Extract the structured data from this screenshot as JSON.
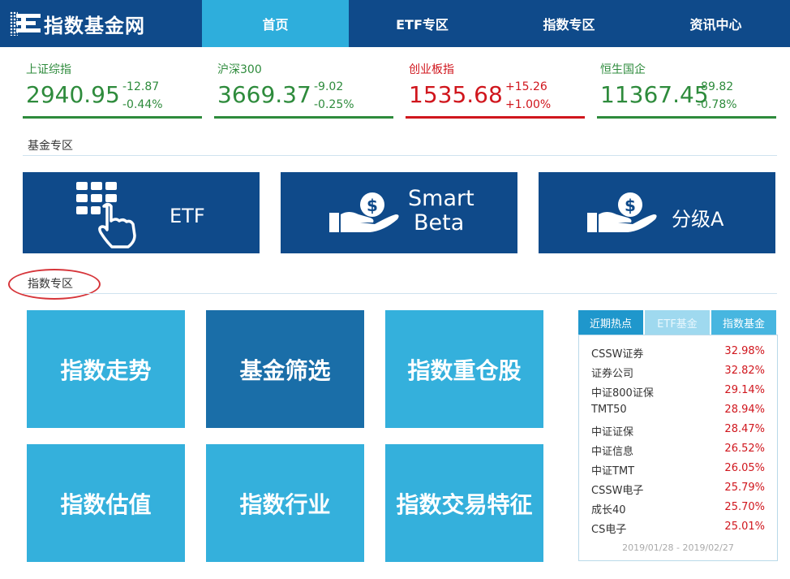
{
  "site": {
    "logo_text": "指数基金网"
  },
  "nav": {
    "items": [
      "首页",
      "ETF专区",
      "指数专区",
      "资讯中心"
    ],
    "active": 0
  },
  "quotes": [
    {
      "name": "上证综指",
      "value": "2940.95",
      "change": "-12.87",
      "pct": "-0.44%",
      "trend": "down",
      "color": "#2e8b3c"
    },
    {
      "name": "沪深300",
      "value": "3669.37",
      "change": "-9.02",
      "pct": "-0.25%",
      "trend": "down",
      "color": "#2e8b3c"
    },
    {
      "name": "创业板指",
      "value": "1535.68",
      "change": "+15.26",
      "pct": "+1.00%",
      "trend": "up",
      "color": "#d0161d"
    },
    {
      "name": "恒生国企",
      "value": "11367.45",
      "change": "-89.82",
      "pct": "-0.78%",
      "trend": "down",
      "color": "#2e8b3c"
    }
  ],
  "fund_section": {
    "title": "基金专区",
    "buttons": [
      {
        "label": "ETF",
        "icon": "keypad-hand-icon"
      },
      {
        "label_line1": "Smart",
        "label_line2": "Beta",
        "icon": "hand-coin-icon"
      },
      {
        "label": "分级A",
        "icon": "hand-coin-icon"
      }
    ]
  },
  "index_section": {
    "title": "指数专区",
    "tiles": [
      "指数走势",
      "基金筛选",
      "指数重仓股",
      "指数估值",
      "指数行业",
      "指数交易特征"
    ]
  },
  "hot": {
    "tabs": [
      "近期热点",
      "ETF基金",
      "指数基金"
    ],
    "active_tab": 0,
    "rows": [
      {
        "name": "CSSW证券",
        "pct": "32.98%"
      },
      {
        "name": "证券公司",
        "pct": "32.82%"
      },
      {
        "name": "中证800证保",
        "pct": "29.14%"
      },
      {
        "name": "TMT50",
        "pct": "28.94%"
      },
      {
        "name": "中证证保",
        "pct": "28.47%"
      },
      {
        "name": "中证信息",
        "pct": "26.52%"
      },
      {
        "name": "中证TMT",
        "pct": "26.05%"
      },
      {
        "name": "CSSW电子",
        "pct": "25.79%"
      },
      {
        "name": "成长40",
        "pct": "25.70%"
      },
      {
        "name": "CS电子",
        "pct": "25.01%"
      }
    ],
    "date_range": "2019/01/28 - 2019/02/27"
  }
}
